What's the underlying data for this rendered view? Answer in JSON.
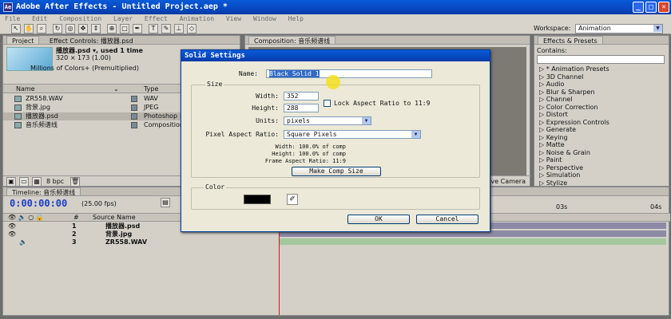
{
  "window": {
    "title": "Adobe After Effects - Untitled Project.aep *"
  },
  "menu": [
    "File",
    "Edit",
    "Composition",
    "Layer",
    "Effect",
    "Animation",
    "View",
    "Window",
    "Help"
  ],
  "toolbar": {
    "workspace_label": "Workspace:",
    "workspace_value": "Animation"
  },
  "project": {
    "tab_project": "Project",
    "tab_effect_controls": "Effect Controls: 播放器.psd",
    "selected_name": "播放器.psd ▾, used 1 time",
    "selected_size": "320 × 173 (1.00)",
    "selected_colors": "Millions of Colors+ (Premultiplied)",
    "col_name": "Name",
    "col_type": "Type",
    "items": [
      {
        "name": "ZR558.WAV",
        "type": "WAV"
      },
      {
        "name": "背景.jpg",
        "type": "JPEG"
      },
      {
        "name": "播放器.psd",
        "type": "Photoshop"
      },
      {
        "name": "音乐频谱线",
        "type": "Composition"
      }
    ],
    "bpc": "8 bpc"
  },
  "composition": {
    "tab": "Composition: 音乐频谱线",
    "camera": "Active Camera"
  },
  "effects": {
    "tab": "Effects & Presets",
    "contains_label": "Contains:",
    "items": [
      "* Animation Presets",
      "3D Channel",
      "Audio",
      "Blur & Sharpen",
      "Channel",
      "Color Correction",
      "Distort",
      "Expression Controls",
      "Generate",
      "Keying",
      "Matte",
      "Noise & Grain",
      "Paint",
      "Perspective",
      "Simulation",
      "Stylize"
    ]
  },
  "timeline": {
    "tab": "Timeline: 音乐频谱线",
    "timecode": "0:00:00:00",
    "fps": "(25.00 fps)",
    "col_hash": "#",
    "col_source": "Source Name",
    "ruler_03": "03s",
    "ruler_04": "04s",
    "layers": [
      {
        "num": "1",
        "name": "播放器.psd"
      },
      {
        "num": "2",
        "name": "背景.jpg"
      },
      {
        "num": "3",
        "name": "ZR558.WAV"
      }
    ],
    "bar_colors": [
      "#8d8aa6",
      "#8d8aa6",
      "#a4c79e"
    ]
  },
  "dialog": {
    "title": "Solid Settings",
    "name_label": "Name:",
    "name_value": "Black Solid 1",
    "size_group": "Size",
    "width_label": "Width:",
    "width_value": "352",
    "height_label": "Height:",
    "height_value": "288",
    "lock_label": "Lock Aspect Ratio to 11:9",
    "units_label": "Units:",
    "units_value": "pixels",
    "par_label": "Pixel Aspect Ratio:",
    "par_value": "Square Pixels",
    "info_width": "Width:  100.0% of comp",
    "info_height": "Height:  100.0% of comp",
    "info_frame": "Frame Aspect Ratio: 11:9",
    "make_comp_size": "Make Comp Size",
    "color_group": "Color",
    "color_value": "#000000",
    "ok": "OK",
    "cancel": "Cancel"
  }
}
